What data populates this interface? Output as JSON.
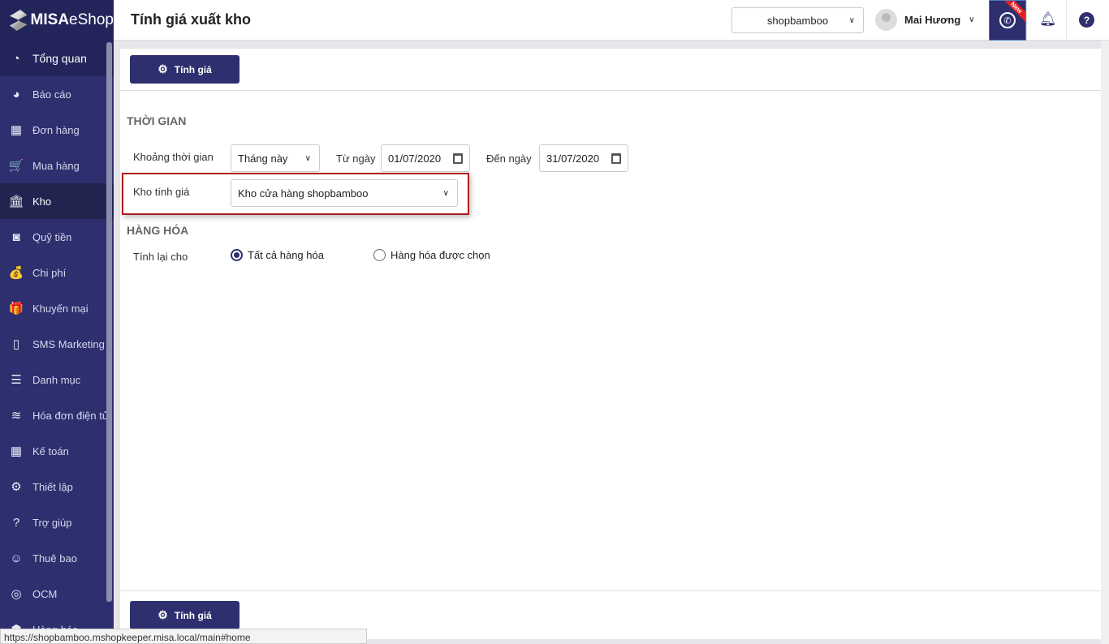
{
  "brand": {
    "name_bold": "MISA",
    "name_rest": "eShop"
  },
  "sidebar": {
    "items": [
      {
        "label": "Tổng quan",
        "icon": "dashboard-icon",
        "glyph": "◔"
      },
      {
        "label": "Báo cáo",
        "icon": "pie-chart-icon",
        "glyph": "◕"
      },
      {
        "label": "Đơn hàng",
        "icon": "order-icon",
        "glyph": "▦"
      },
      {
        "label": "Mua hàng",
        "icon": "cart-icon",
        "glyph": "🛒"
      },
      {
        "label": "Kho",
        "icon": "warehouse-icon",
        "glyph": "🏛"
      },
      {
        "label": "Quỹ tiền",
        "icon": "safe-icon",
        "glyph": "◙"
      },
      {
        "label": "Chi phí",
        "icon": "money-bag-icon",
        "glyph": "💰"
      },
      {
        "label": "Khuyến mại",
        "icon": "gift-icon",
        "glyph": "🎁"
      },
      {
        "label": "SMS Marketing",
        "icon": "phone-icon",
        "glyph": "▯"
      },
      {
        "label": "Danh mục",
        "icon": "list-icon",
        "glyph": "☰"
      },
      {
        "label": "Hóa đơn điện tử",
        "icon": "einvoice-icon",
        "glyph": "≋"
      },
      {
        "label": "Kế toán",
        "icon": "calculator-icon",
        "glyph": "▦"
      },
      {
        "label": "Thiết lập",
        "icon": "gear-icon",
        "glyph": "⚙"
      },
      {
        "label": "Trợ giúp",
        "icon": "help-icon",
        "glyph": "?"
      },
      {
        "label": "Thuê bao",
        "icon": "user-icon",
        "glyph": "☺"
      },
      {
        "label": "OCM",
        "icon": "ocm-icon",
        "glyph": "◎"
      },
      {
        "label": "Hàng hóa",
        "icon": "box-icon",
        "glyph": "⬢"
      }
    ],
    "active": "Kho"
  },
  "header": {
    "title": "Tính giá xuất kho",
    "shop": "shopbamboo",
    "user": "Mai Hương",
    "new_badge": "New"
  },
  "toolbar": {
    "calc_label": "Tính giá"
  },
  "time_section": {
    "title": "THỜI GIAN",
    "period_label": "Khoảng thời gian",
    "period_value": "Tháng này",
    "from_label": "Từ ngày",
    "from_value": "01/07/2020",
    "to_label": "Đến ngày",
    "to_value": "31/07/2020",
    "warehouse_label": "Kho tính giá",
    "warehouse_value": "Kho cửa hàng shopbamboo"
  },
  "goods_section": {
    "title": "HÀNG HÓA",
    "recalc_label": "Tính lại cho",
    "option_all": "Tất cả hàng hóa",
    "option_selected": "Hàng hóa được chọn",
    "selected": "all"
  },
  "status_bar": "https://shopbamboo.mshopkeeper.misa.local/main#home",
  "colors": {
    "primary": "#2d2f6e",
    "highlight": "#b01c1c"
  }
}
